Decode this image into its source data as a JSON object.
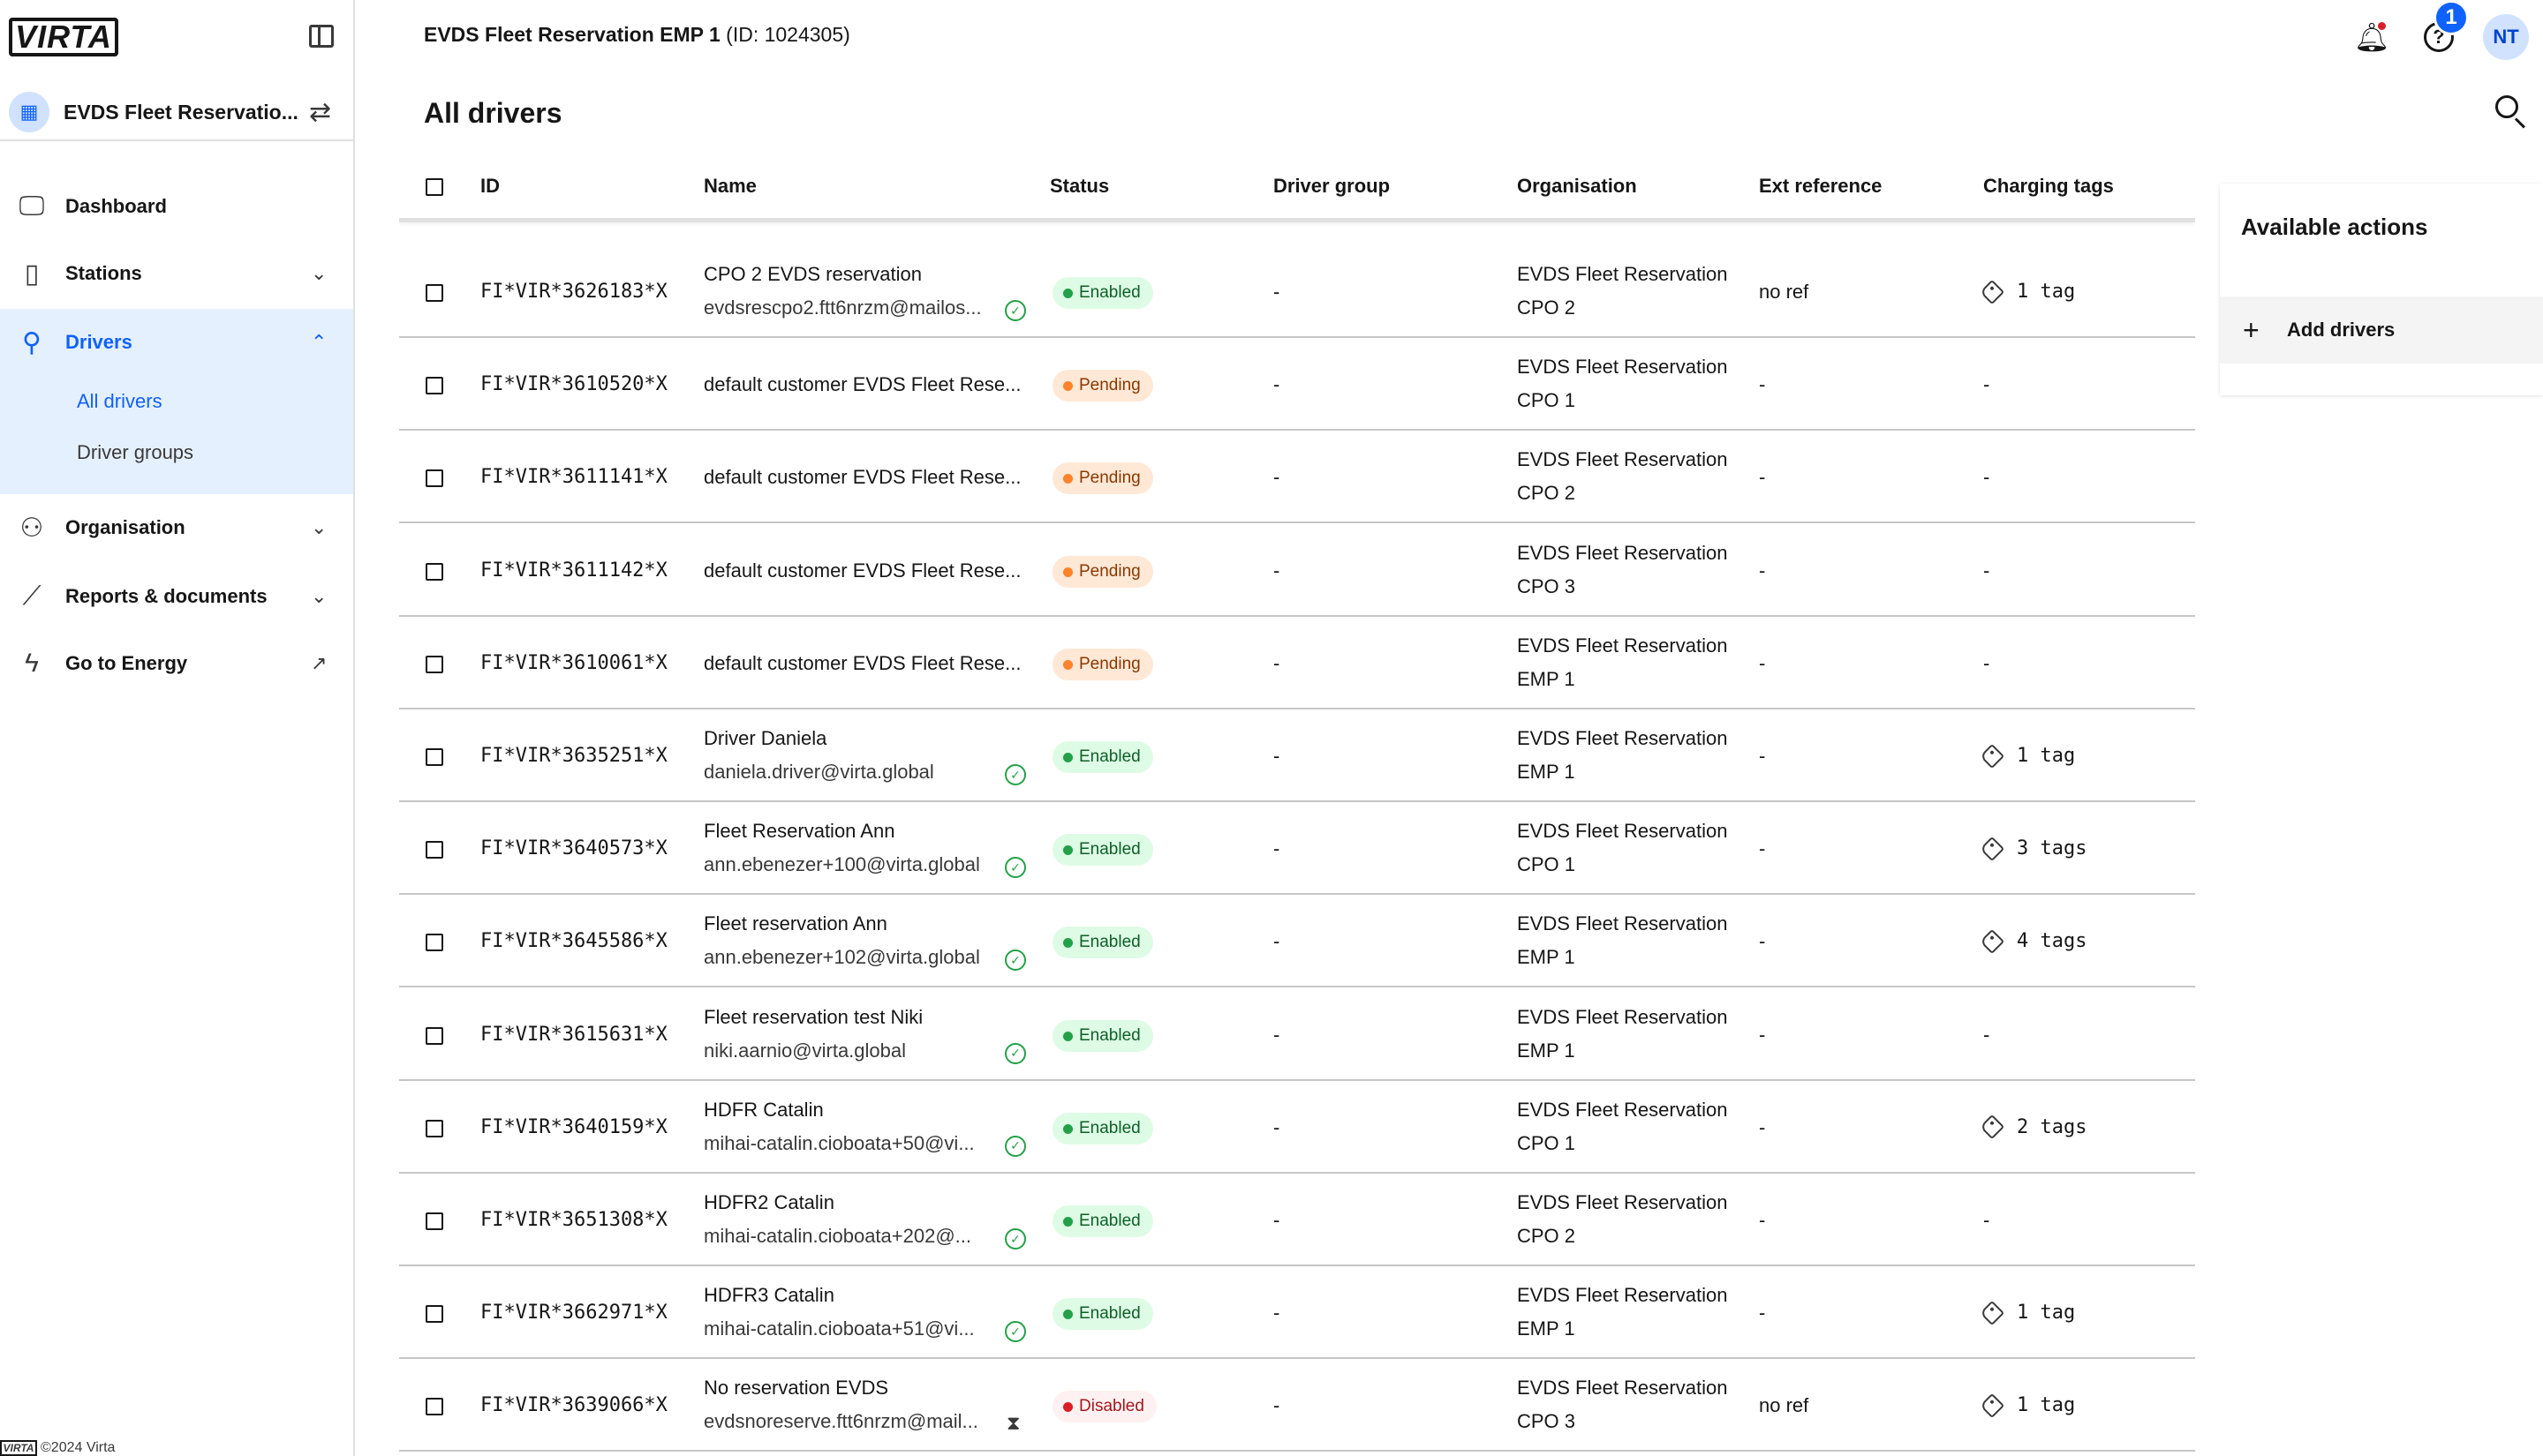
{
  "app": {
    "logo": "VIRTA",
    "footer": "©2024 Virta"
  },
  "header": {
    "org_name": "EVDS Fleet Reservation EMP 1",
    "org_id": "(ID: 1024305)",
    "page_title": "All drivers",
    "help_badge": "1",
    "user_initials": "NT"
  },
  "sidebar": {
    "org_switch_label": "EVDS Fleet Reservatio...",
    "items": [
      {
        "label": "Dashboard",
        "icon": "dashboard-icon"
      },
      {
        "label": "Stations",
        "icon": "station-icon"
      },
      {
        "label": "Drivers",
        "icon": "driver-icon"
      },
      {
        "label": "Organisation",
        "icon": "organisation-icon"
      },
      {
        "label": "Reports & documents",
        "icon": "chart-icon"
      },
      {
        "label": "Go to Energy",
        "icon": "lightning-icon"
      }
    ],
    "drivers_sub": [
      {
        "label": "All drivers"
      },
      {
        "label": "Driver groups"
      }
    ]
  },
  "table": {
    "columns": [
      "ID",
      "Name",
      "Status",
      "Driver group",
      "Organisation",
      "Ext reference",
      "Charging tags"
    ],
    "rows": [
      {
        "id": "FI*VIR*3626183*X",
        "name": "CPO 2 EVDS reservation",
        "email": "evdsrescpo2.ftt6nrzm@mailos...",
        "verify": "check",
        "status": "Enabled",
        "status_kind": "enabled",
        "group": "-",
        "org1": "EVDS Fleet Reservation",
        "org2": "CPO 2",
        "ext": "no ref",
        "tags": "1 tag"
      },
      {
        "id": "FI*VIR*3610520*X",
        "name": "default customer EVDS Fleet Rese...",
        "email": "",
        "verify": "",
        "status": "Pending",
        "status_kind": "pending",
        "group": "-",
        "org1": "EVDS Fleet Reservation",
        "org2": "CPO 1",
        "ext": "-",
        "tags": "-"
      },
      {
        "id": "FI*VIR*3611141*X",
        "name": "default customer EVDS Fleet Rese...",
        "email": "",
        "verify": "",
        "status": "Pending",
        "status_kind": "pending",
        "group": "-",
        "org1": "EVDS Fleet Reservation",
        "org2": "CPO 2",
        "ext": "-",
        "tags": "-"
      },
      {
        "id": "FI*VIR*3611142*X",
        "name": "default customer EVDS Fleet Rese...",
        "email": "",
        "verify": "",
        "status": "Pending",
        "status_kind": "pending",
        "group": "-",
        "org1": "EVDS Fleet Reservation",
        "org2": "CPO 3",
        "ext": "-",
        "tags": "-"
      },
      {
        "id": "FI*VIR*3610061*X",
        "name": "default customer EVDS Fleet Rese...",
        "email": "",
        "verify": "",
        "status": "Pending",
        "status_kind": "pending",
        "group": "-",
        "org1": "EVDS Fleet Reservation",
        "org2": "EMP 1",
        "ext": "-",
        "tags": "-"
      },
      {
        "id": "FI*VIR*3635251*X",
        "name": "Driver Daniela",
        "email": "daniela.driver@virta.global",
        "verify": "check",
        "status": "Enabled",
        "status_kind": "enabled",
        "group": "-",
        "org1": "EVDS Fleet Reservation",
        "org2": "EMP 1",
        "ext": "-",
        "tags": "1 tag"
      },
      {
        "id": "FI*VIR*3640573*X",
        "name": "Fleet Reservation Ann",
        "email": "ann.ebenezer+100@virta.global",
        "verify": "check",
        "status": "Enabled",
        "status_kind": "enabled",
        "group": "-",
        "org1": "EVDS Fleet Reservation",
        "org2": "CPO 1",
        "ext": "-",
        "tags": "3 tags"
      },
      {
        "id": "FI*VIR*3645586*X",
        "name": "Fleet reservation Ann",
        "email": "ann.ebenezer+102@virta.global",
        "verify": "check",
        "status": "Enabled",
        "status_kind": "enabled",
        "group": "-",
        "org1": "EVDS Fleet Reservation",
        "org2": "EMP 1",
        "ext": "-",
        "tags": "4 tags"
      },
      {
        "id": "FI*VIR*3615631*X",
        "name": "Fleet reservation test Niki",
        "email": "niki.aarnio@virta.global",
        "verify": "check",
        "status": "Enabled",
        "status_kind": "enabled",
        "group": "-",
        "org1": "EVDS Fleet Reservation",
        "org2": "EMP 1",
        "ext": "-",
        "tags": "-"
      },
      {
        "id": "FI*VIR*3640159*X",
        "name": "HDFR Catalin",
        "email": "mihai-catalin.cioboata+50@vi...",
        "verify": "check",
        "status": "Enabled",
        "status_kind": "enabled",
        "group": "-",
        "org1": "EVDS Fleet Reservation",
        "org2": "CPO 1",
        "ext": "-",
        "tags": "2 tags"
      },
      {
        "id": "FI*VIR*3651308*X",
        "name": "HDFR2 Catalin",
        "email": "mihai-catalin.cioboata+202@...",
        "verify": "check",
        "status": "Enabled",
        "status_kind": "enabled",
        "group": "-",
        "org1": "EVDS Fleet Reservation",
        "org2": "CPO 2",
        "ext": "-",
        "tags": "-"
      },
      {
        "id": "FI*VIR*3662971*X",
        "name": "HDFR3 Catalin",
        "email": "mihai-catalin.cioboata+51@vi...",
        "verify": "check",
        "status": "Enabled",
        "status_kind": "enabled",
        "group": "-",
        "org1": "EVDS Fleet Reservation",
        "org2": "EMP 1",
        "ext": "-",
        "tags": "1 tag"
      },
      {
        "id": "FI*VIR*3639066*X",
        "name": "No reservation EVDS",
        "email": "evdsnoreserve.ftt6nrzm@mail...",
        "verify": "hourglass",
        "status": "Disabled",
        "status_kind": "disabled",
        "group": "-",
        "org1": "EVDS Fleet Reservation",
        "org2": "CPO 3",
        "ext": "no ref",
        "tags": "1 tag"
      }
    ]
  },
  "actions": {
    "title": "Available actions",
    "items": [
      {
        "label": "Add drivers",
        "icon": "plus-icon"
      }
    ]
  }
}
